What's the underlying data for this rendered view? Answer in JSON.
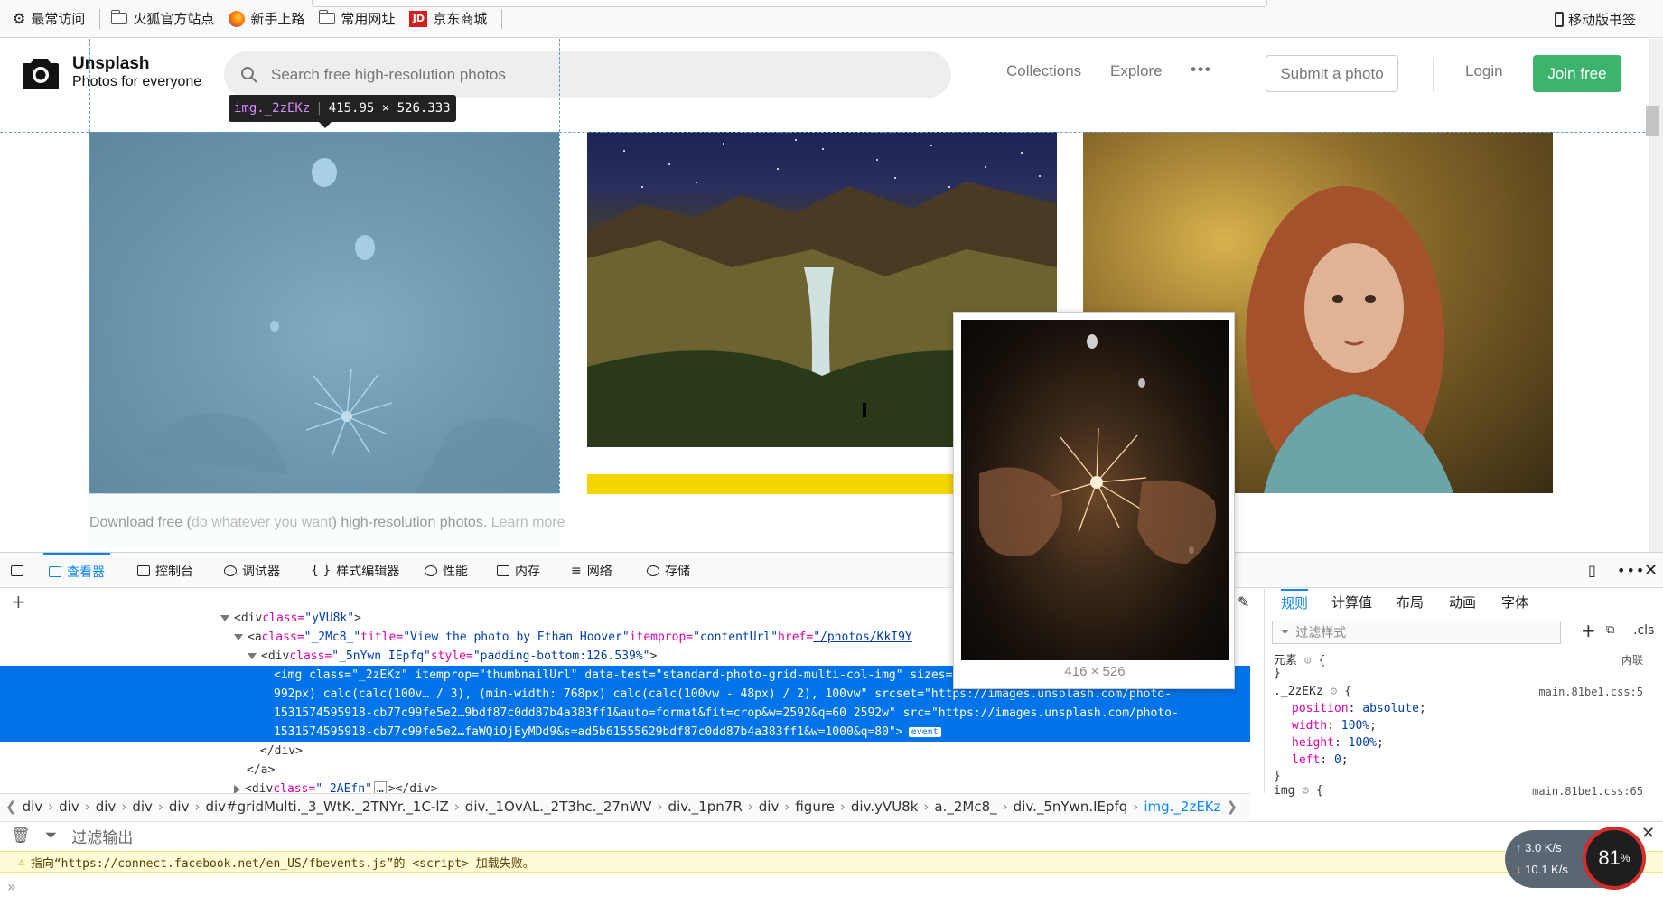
{
  "bookmarks": {
    "items": [
      {
        "label": "最常访问",
        "icon": "gear-icon"
      },
      {
        "label": "火狐官方站点",
        "icon": "folder-icon"
      },
      {
        "label": "新手上路",
        "icon": "firefox-icon"
      },
      {
        "label": "常用网址",
        "icon": "folder-icon"
      },
      {
        "label": "京东商城",
        "icon": "jd-icon",
        "icon_text": "JD"
      }
    ],
    "mobile": "移动版书签"
  },
  "site": {
    "brand_title": "Unsplash",
    "brand_sub": "Photos for everyone",
    "search_placeholder": "Search free high-resolution photos",
    "nav": [
      "Collections",
      "Explore"
    ],
    "more": "•••",
    "submit": "Submit a photo",
    "login": "Login",
    "join": "Join free",
    "footer_prefix": "Download free (",
    "footer_link1": "do whatever you want",
    "footer_mid": ") high-resolution photos. ",
    "footer_link2": "Learn more",
    "join_color": "#3cb46e"
  },
  "highlight": {
    "tag": "img._2zEKz",
    "dims": "415.95 × 526.333"
  },
  "devtools": {
    "tabs": [
      "查看器",
      "控制台",
      "调试器",
      "样式编辑器",
      "性能",
      "内存",
      "网络",
      "存储"
    ],
    "markup": {
      "line1_tag": "<div ",
      "line1_attr": "class=",
      "line1_val": "\"yVU8k\"",
      "line1_end": ">",
      "line2_a": "<a ",
      "line2_c": "class=",
      "line2_cv": "\"_2Mc8_\"",
      "line2_t": " title=",
      "line2_tv": "\"View the photo by Ethan Hoover\"",
      "line2_i": " itemprop=",
      "line2_iv": "\"contentUrl\"",
      "line2_h": " href=",
      "line2_hv": "\"/photos/KkI9Y",
      "line3_tag": "<div ",
      "line3_c": "class=",
      "line3_cv": "\"_5nYwn IEpfq\"",
      "line3_s": " style=",
      "line3_sv": "\"padding-bottom:126.539%\"",
      "line3_end": ">",
      "sel1": "<img class=\"_2zEKz\" itemprop=\"thumbnailUrl\" data-test=\"standard-photo-grid-multi-col-img\" sizes=\"(min-width: 992px) 416px, (min-width:",
      "sel2": "992px) calc(calc(100v… / 3), (min-width: 768px) calc(calc(100vw - 48px) / 2), 100vw\" srcset=\"https://images.unsplash.com/photo-",
      "sel3": "1531574595918-cb77c99fe5e2…9bdf87c0dd87b4a383ff1&auto=format&fit=crop&w=2592&q=60 2592w\" src=\"https://images.unsplash.com/photo-",
      "sel4": "1531574595918-cb77c99fe5e2…faWQiOjEyMDd9&s=ad5b61555629bdf87c0dd87b4a383ff1&w=1000&q=80\">",
      "event": "event",
      "close_div": "</div>",
      "close_a": "</a>",
      "last_tag": "<div ",
      "last_c": "class=",
      "last_cv": "\"_2AEfn\"",
      "last_end": "></div>",
      "last_dots": "…"
    },
    "breadcrumbs": [
      "div",
      "div",
      "div",
      "div",
      "div",
      "div#gridMulti._3_WtK._2TNYr._1C-lZ",
      "div._1OvAL._2T3hc._27nWV",
      "div._1pn7R",
      "div",
      "figure",
      "div.yVU8k",
      "a._2Mc8_",
      "div._5nYwn.IEpfq",
      "img._2zEKz"
    ],
    "rules_tabs": [
      "规则",
      "计算值",
      "布局",
      "动画",
      "字体"
    ],
    "rules_filter": "过滤样式",
    "cls": ".cls",
    "rules": {
      "element_sel": "元素",
      "element_brace": "{",
      "inline": "内联",
      "close": "}",
      "rule2_sel": "._2zEKz",
      "rule2_src": "main.81be1.css:5",
      "rule2_props": [
        {
          "p": "position",
          "v": "absolute"
        },
        {
          "p": "width",
          "v": "100%"
        },
        {
          "p": "height",
          "v": "100%"
        },
        {
          "p": "left",
          "v": "0"
        }
      ],
      "rule3_sel": "img",
      "rule3_src": "main.81be1.css:65"
    },
    "console_filter": "过滤输出",
    "console_warning": "指向“https://connect.facebook.net/en_US/fbevents.js”的 <script> 加载失败。",
    "console_prompt": "»",
    "preview_size": "416 × 526"
  },
  "netmon": {
    "up": "3.0 K/s",
    "down": "10.1 K/s",
    "percent": "81",
    "percent_sign": "%"
  }
}
